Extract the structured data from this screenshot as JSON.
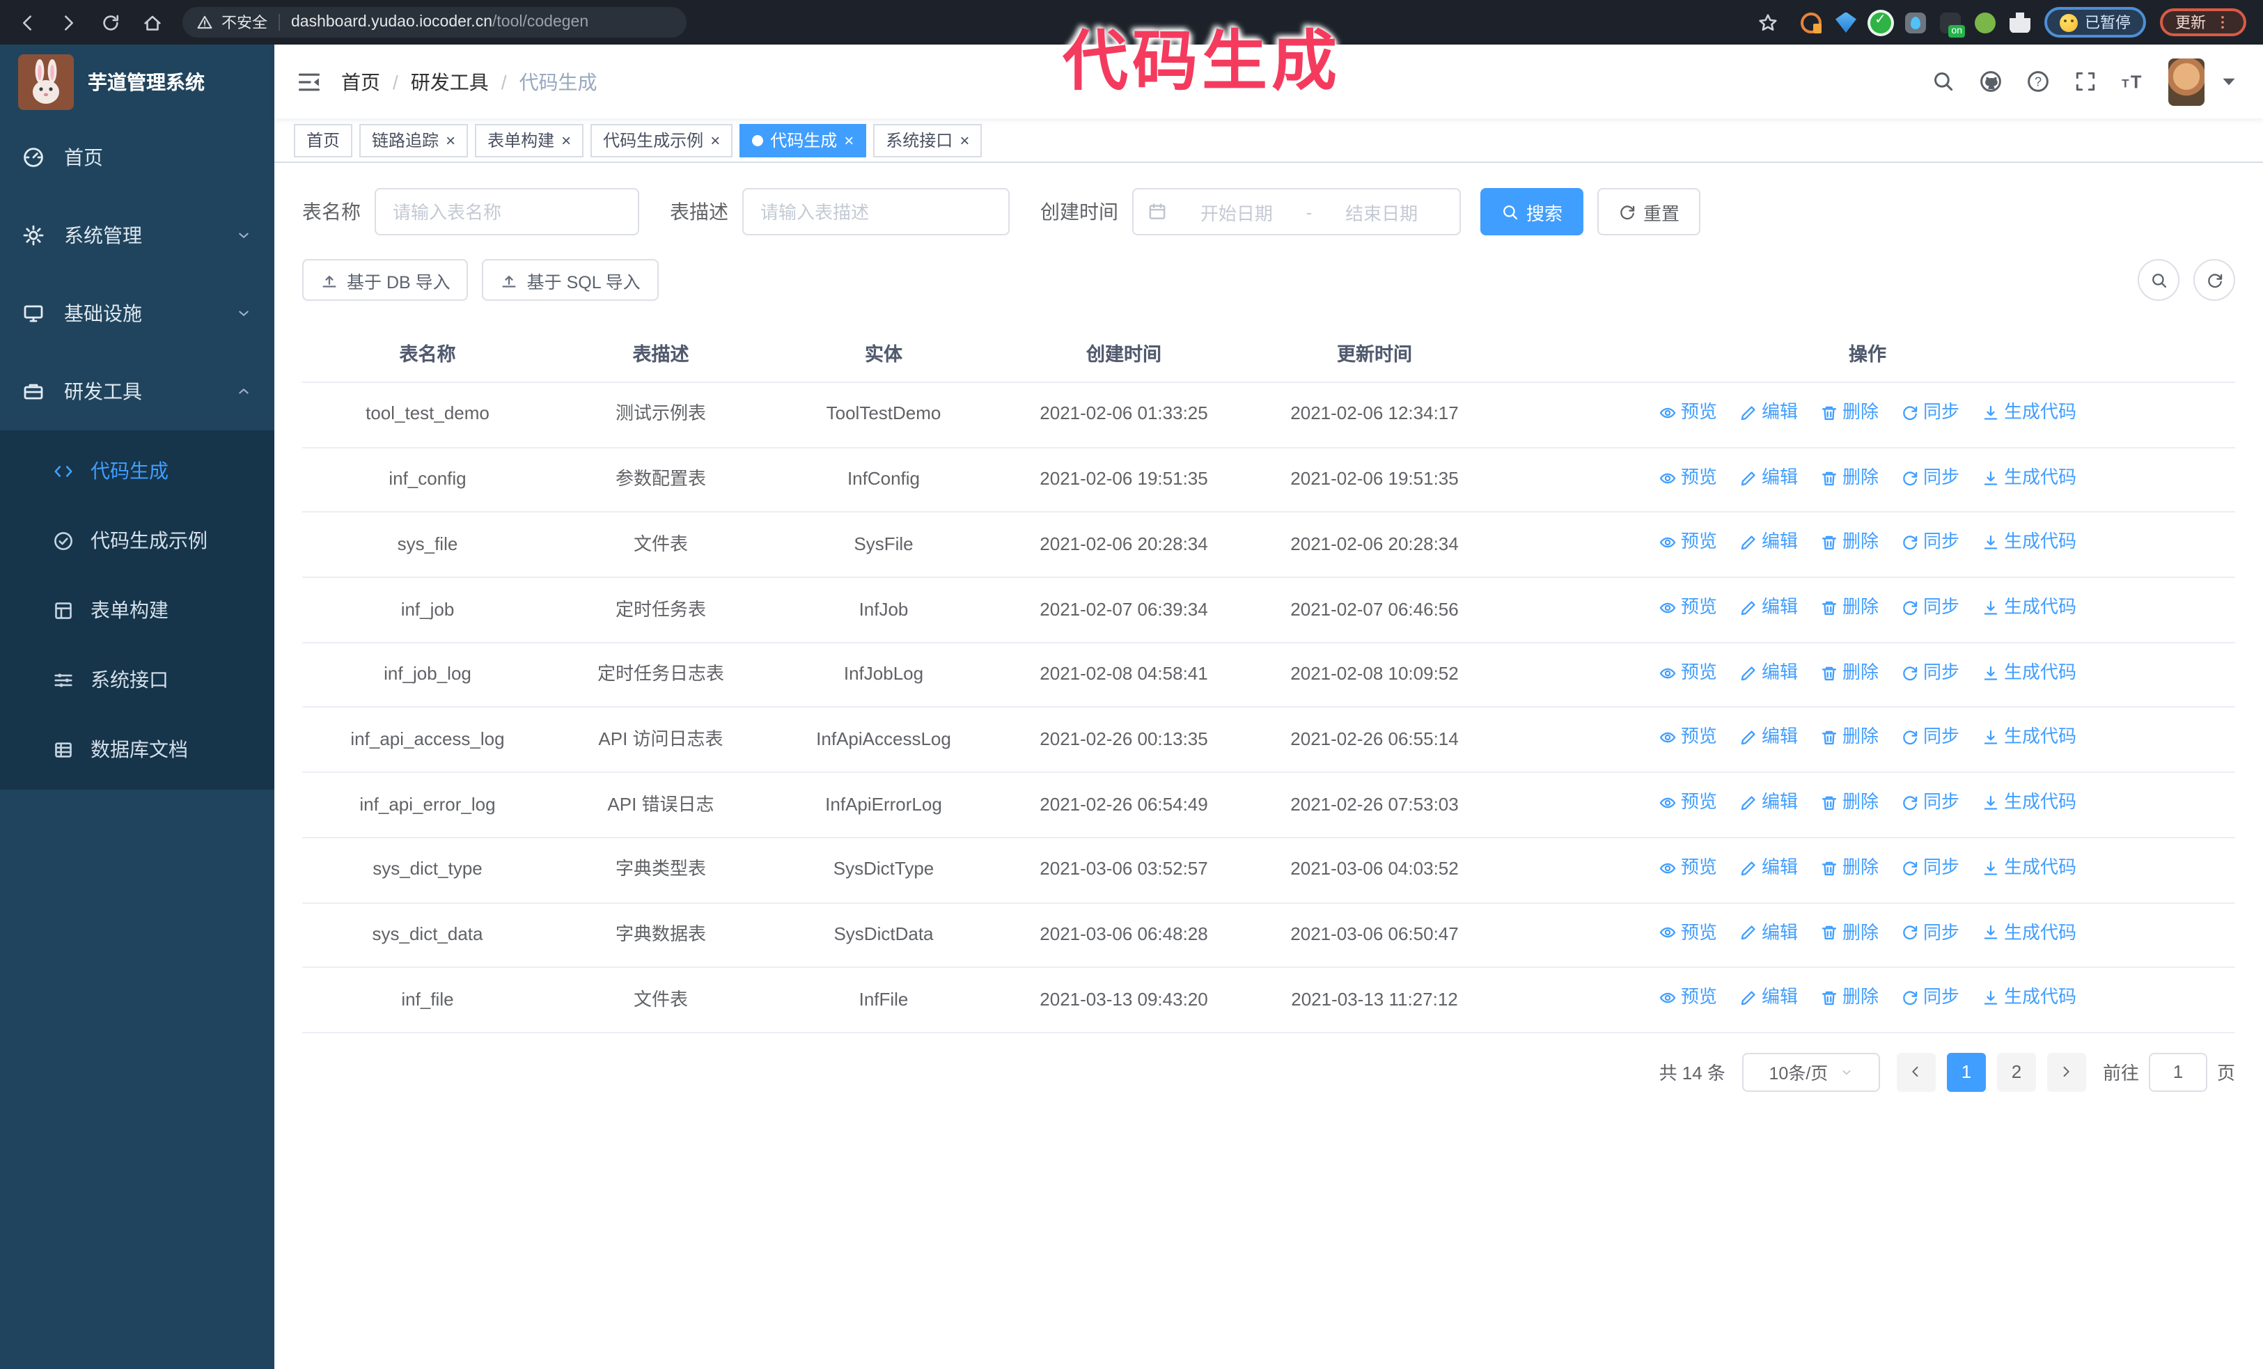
{
  "colors": {
    "accent": "#409eff",
    "sidebar_bg": "#20445d",
    "submenu_bg": "#16344a",
    "annotation": "#f43b5e",
    "active_tab_bg": "#409eff"
  },
  "annotation": {
    "text": "代码生成"
  },
  "browser": {
    "security_label": "不安全",
    "url_host": "dashboard.yudao.iocoder.cn",
    "url_path": "/tool/codegen",
    "extensions": [
      "orange-extension-icon",
      "blue-gem-extension-icon",
      "green-check-extension-icon",
      "gray-drop-extension-icon",
      "dark-on-extension-icon",
      "green-round-extension-icon",
      "puzzle-extension-icon"
    ],
    "paused_badge": "已暂停",
    "update_label": "更新"
  },
  "sidebar": {
    "app_title": "芋道管理系统",
    "items": [
      {
        "label": "首页",
        "icon": "gauge-icon",
        "expand": null
      },
      {
        "label": "系统管理",
        "icon": "gear-icon",
        "expand": "down"
      },
      {
        "label": "基础设施",
        "icon": "monitor-icon",
        "expand": "down"
      },
      {
        "label": "研发工具",
        "icon": "toolbox-icon",
        "expand": "up"
      }
    ],
    "subitems": [
      {
        "label": "代码生成",
        "icon": "code-icon",
        "active": true
      },
      {
        "label": "代码生成示例",
        "icon": "example-icon",
        "active": false
      },
      {
        "label": "表单构建",
        "icon": "form-icon",
        "active": false
      },
      {
        "label": "系统接口",
        "icon": "sliders-icon",
        "active": false
      },
      {
        "label": "数据库文档",
        "icon": "database-icon",
        "active": false
      }
    ]
  },
  "header": {
    "breadcrumb": [
      "首页",
      "研发工具",
      "代码生成"
    ]
  },
  "tabs": [
    {
      "label": "首页",
      "closable": false,
      "active": false
    },
    {
      "label": "链路追踪",
      "closable": true,
      "active": false
    },
    {
      "label": "表单构建",
      "closable": true,
      "active": false
    },
    {
      "label": "代码生成示例",
      "closable": true,
      "active": false
    },
    {
      "label": "代码生成",
      "closable": true,
      "active": true
    },
    {
      "label": "系统接口",
      "closable": true,
      "active": false
    }
  ],
  "filters": {
    "table_name_label": "表名称",
    "table_name_placeholder": "请输入表名称",
    "table_desc_label": "表描述",
    "table_desc_placeholder": "请输入表描述",
    "create_time_label": "创建时间",
    "date_start_placeholder": "开始日期",
    "date_separator": "-",
    "date_end_placeholder": "结束日期",
    "search_label": "搜索",
    "reset_label": "重置"
  },
  "toolbar": {
    "import_db_label": "基于 DB 导入",
    "import_sql_label": "基于 SQL 导入"
  },
  "table": {
    "columns": [
      "表名称",
      "表描述",
      "实体",
      "创建时间",
      "更新时间",
      "操作"
    ],
    "actions": [
      "预览",
      "编辑",
      "删除",
      "同步",
      "生成代码"
    ],
    "rows": [
      {
        "name": "tool_test_demo",
        "desc": "测试示例表",
        "entity": "ToolTestDemo",
        "created": "2021-02-06 01:33:25",
        "updated": "2021-02-06 12:34:17"
      },
      {
        "name": "inf_config",
        "desc": "参数配置表",
        "entity": "InfConfig",
        "created": "2021-02-06 19:51:35",
        "updated": "2021-02-06 19:51:35"
      },
      {
        "name": "sys_file",
        "desc": "文件表",
        "entity": "SysFile",
        "created": "2021-02-06 20:28:34",
        "updated": "2021-02-06 20:28:34"
      },
      {
        "name": "inf_job",
        "desc": "定时任务表",
        "entity": "InfJob",
        "created": "2021-02-07 06:39:34",
        "updated": "2021-02-07 06:46:56"
      },
      {
        "name": "inf_job_log",
        "desc": "定时任务日志表",
        "entity": "InfJobLog",
        "created": "2021-02-08 04:58:41",
        "updated": "2021-02-08 10:09:52"
      },
      {
        "name": "inf_api_access_log",
        "desc": "API 访问日志表",
        "entity": "InfApiAccessLog",
        "created": "2021-02-26 00:13:35",
        "updated": "2021-02-26 06:55:14"
      },
      {
        "name": "inf_api_error_log",
        "desc": "API 错误日志",
        "entity": "InfApiErrorLog",
        "created": "2021-02-26 06:54:49",
        "updated": "2021-02-26 07:53:03"
      },
      {
        "name": "sys_dict_type",
        "desc": "字典类型表",
        "entity": "SysDictType",
        "created": "2021-03-06 03:52:57",
        "updated": "2021-03-06 04:03:52"
      },
      {
        "name": "sys_dict_data",
        "desc": "字典数据表",
        "entity": "SysDictData",
        "created": "2021-03-06 06:48:28",
        "updated": "2021-03-06 06:50:47"
      },
      {
        "name": "inf_file",
        "desc": "文件表",
        "entity": "InfFile",
        "created": "2021-03-13 09:43:20",
        "updated": "2021-03-13 11:27:12"
      }
    ]
  },
  "pagination": {
    "total_label": "共 14 条",
    "page_size": "10条/页",
    "pages": [
      "1",
      "2"
    ],
    "active_page": "1",
    "goto_label": "前往",
    "goto_value": "1",
    "goto_suffix": "页"
  }
}
